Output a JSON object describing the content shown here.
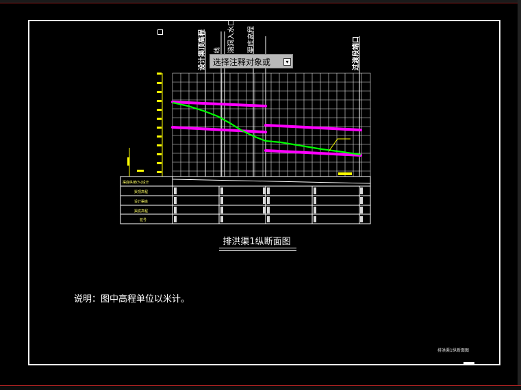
{
  "drawing": {
    "title": "排洪渠1纵断面图",
    "note": "说明：图中高程单位以米计。",
    "corner_label": "排洪渠1纵断面图"
  },
  "popup": {
    "text": "选择注释对象或",
    "icon": "dropdown-icon"
  },
  "station_labels": {
    "label_a": "设计渠顶高程",
    "label_b": "线",
    "label_c": "涵洞入水口",
    "label_d": "渠底高程",
    "label_e": "过渡段端口"
  },
  "table": {
    "row_labels": [
      "渠底纵坡(%)设计",
      "渠顶高程",
      "设计渠底",
      "渠底高程",
      "桩号"
    ]
  },
  "colors": {
    "background": "#000000",
    "frame": "#ffffff",
    "grid": "#ffffff",
    "magenta_lines": "#ff00ff",
    "green_line": "#00ff00",
    "yellow_text": "#ffff00"
  }
}
